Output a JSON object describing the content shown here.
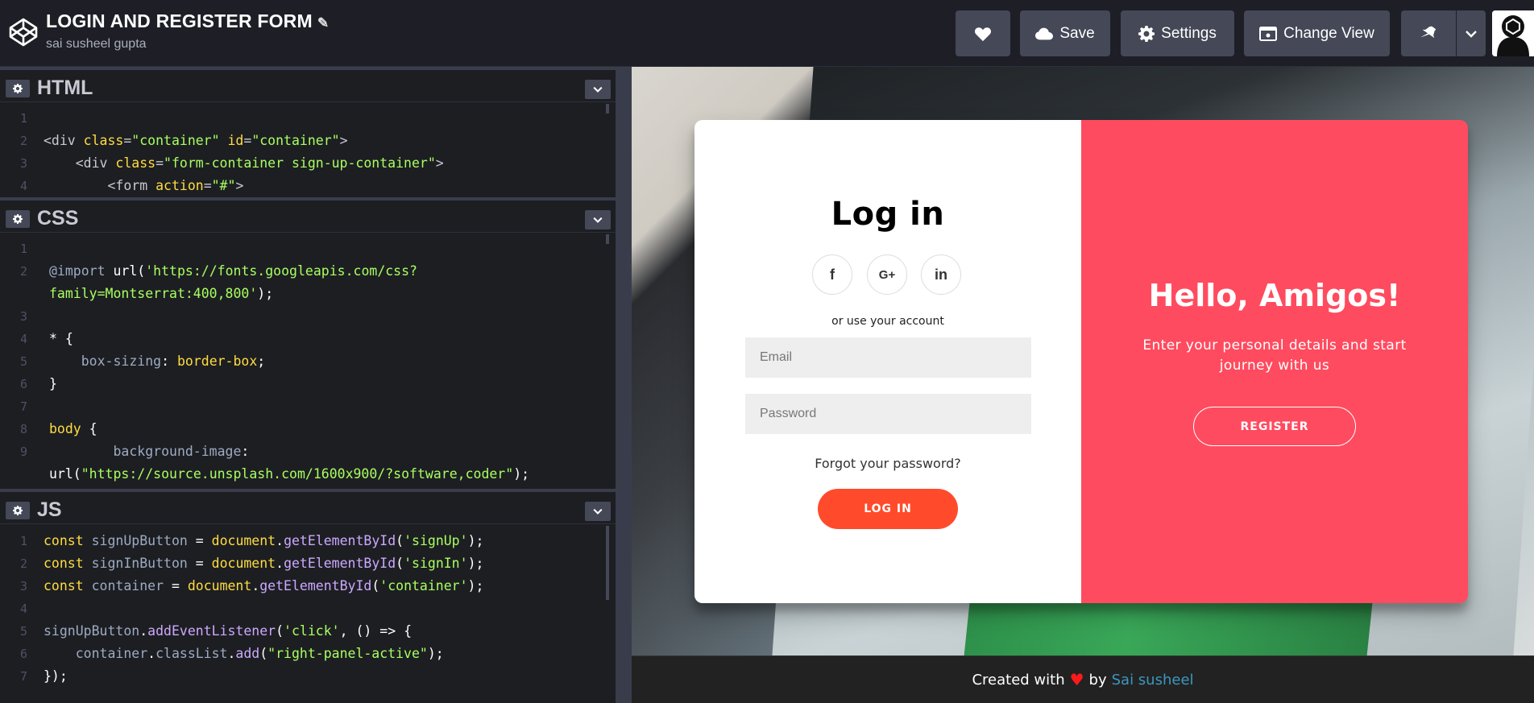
{
  "header": {
    "title": "LOGIN AND REGISTER FORM",
    "author": "sai susheel gupta",
    "buttons": {
      "save": "Save",
      "settings": "Settings",
      "change_view": "Change View"
    }
  },
  "editors": {
    "html": {
      "name": "HTML",
      "lines": [
        {
          "n": "1",
          "parts": []
        },
        {
          "n": "2",
          "parts": [
            [
              "t-tag",
              "<div "
            ],
            [
              "t-attr",
              "class"
            ],
            [
              "t-tag",
              "="
            ],
            [
              "t-str",
              "\"container\""
            ],
            [
              "t-tag",
              " "
            ],
            [
              "t-attr",
              "id"
            ],
            [
              "t-tag",
              "="
            ],
            [
              "t-str",
              "\"container\""
            ],
            [
              "t-tag",
              ">"
            ]
          ]
        },
        {
          "n": "3",
          "parts": [
            [
              "t-tag",
              "    <div "
            ],
            [
              "t-attr",
              "class"
            ],
            [
              "t-tag",
              "="
            ],
            [
              "t-str",
              "\"form-container sign-up-container\""
            ],
            [
              "t-tag",
              ">"
            ]
          ]
        },
        {
          "n": "4",
          "parts": [
            [
              "t-tag",
              "        <form "
            ],
            [
              "t-attr",
              "action"
            ],
            [
              "t-tag",
              "="
            ],
            [
              "t-str",
              "\"#\""
            ],
            [
              "t-tag",
              ">"
            ]
          ]
        }
      ]
    },
    "css": {
      "name": "CSS",
      "lines": [
        {
          "n": "1",
          "parts": []
        },
        {
          "n": "2",
          "parts": [
            [
              "t-prop",
              "@import "
            ],
            [
              "t-plain",
              "url("
            ],
            [
              "t-str",
              "'https://fonts.googleapis.com/css?"
            ]
          ]
        },
        {
          "n": "",
          "parts": [
            [
              "t-str",
              "family=Montserrat:400,800'"
            ],
            [
              "t-plain",
              ");"
            ]
          ]
        },
        {
          "n": "3",
          "parts": []
        },
        {
          "n": "4",
          "parts": [
            [
              "t-plain",
              "* {"
            ]
          ]
        },
        {
          "n": "5",
          "parts": [
            [
              "t-prop",
              "    box-sizing"
            ],
            [
              "t-plain",
              ": "
            ],
            [
              "t-val",
              "border-box"
            ],
            [
              "t-plain",
              ";"
            ]
          ]
        },
        {
          "n": "6",
          "parts": [
            [
              "t-plain",
              "}"
            ]
          ]
        },
        {
          "n": "7",
          "parts": []
        },
        {
          "n": "8",
          "parts": [
            [
              "t-val",
              "body"
            ],
            [
              "t-plain",
              " {"
            ]
          ]
        },
        {
          "n": "9",
          "parts": [
            [
              "t-prop",
              "        background-image"
            ],
            [
              "t-plain",
              ":"
            ]
          ]
        },
        {
          "n": "",
          "parts": [
            [
              "t-plain",
              "url("
            ],
            [
              "t-str",
              "\"https://source.unsplash.com/1600x900/?software,coder\""
            ],
            [
              "t-plain",
              ");"
            ]
          ]
        }
      ]
    },
    "js": {
      "name": "JS",
      "lines": [
        {
          "n": "1",
          "parts": [
            [
              "t-fn",
              "const "
            ],
            [
              "t-var",
              "signUpButton"
            ],
            [
              "t-plain",
              " = "
            ],
            [
              "t-fn",
              "document"
            ],
            [
              "t-plain",
              "."
            ],
            [
              "t-key",
              "getElementById"
            ],
            [
              "t-plain",
              "("
            ],
            [
              "t-str",
              "'signUp'"
            ],
            [
              "t-plain",
              ");"
            ]
          ]
        },
        {
          "n": "2",
          "parts": [
            [
              "t-fn",
              "const "
            ],
            [
              "t-var",
              "signInButton"
            ],
            [
              "t-plain",
              " = "
            ],
            [
              "t-fn",
              "document"
            ],
            [
              "t-plain",
              "."
            ],
            [
              "t-key",
              "getElementById"
            ],
            [
              "t-plain",
              "("
            ],
            [
              "t-str",
              "'signIn'"
            ],
            [
              "t-plain",
              ");"
            ]
          ]
        },
        {
          "n": "3",
          "parts": [
            [
              "t-fn",
              "const "
            ],
            [
              "t-var",
              "container"
            ],
            [
              "t-plain",
              " = "
            ],
            [
              "t-fn",
              "document"
            ],
            [
              "t-plain",
              "."
            ],
            [
              "t-key",
              "getElementById"
            ],
            [
              "t-plain",
              "("
            ],
            [
              "t-str",
              "'container'"
            ],
            [
              "t-plain",
              ");"
            ]
          ]
        },
        {
          "n": "4",
          "parts": []
        },
        {
          "n": "5",
          "parts": [
            [
              "t-var",
              "signUpButton"
            ],
            [
              "t-plain",
              "."
            ],
            [
              "t-key",
              "addEventListener"
            ],
            [
              "t-plain",
              "("
            ],
            [
              "t-str",
              "'click'"
            ],
            [
              "t-plain",
              ", () => {"
            ]
          ]
        },
        {
          "n": "6",
          "parts": [
            [
              "t-var",
              "    container"
            ],
            [
              "t-plain",
              "."
            ],
            [
              "t-var",
              "classList"
            ],
            [
              "t-plain",
              "."
            ],
            [
              "t-key",
              "add"
            ],
            [
              "t-plain",
              "("
            ],
            [
              "t-str",
              "\"right-panel-active\""
            ],
            [
              "t-plain",
              ");"
            ]
          ]
        },
        {
          "n": "7",
          "parts": [
            [
              "t-plain",
              "});"
            ]
          ]
        }
      ]
    }
  },
  "preview": {
    "login_title": "Log in",
    "social": {
      "facebook": "f",
      "google": "G+",
      "linkedin": "in"
    },
    "use_account": "or use your account",
    "email_placeholder": "Email",
    "password_placeholder": "Password",
    "forgot": "Forgot your password?",
    "login_button": "LOG IN",
    "hello_title": "Hello, Amigos!",
    "hello_text": "Enter your personal details and start journey with us",
    "register_button": "REGISTER"
  },
  "footer": {
    "created_with": "Created with",
    "by": "by",
    "author_link": "Sai susheel"
  },
  "colors": {
    "accent_red": "#ff4b5f",
    "login_button": "#ff4b2b",
    "link": "#3c97bf"
  }
}
